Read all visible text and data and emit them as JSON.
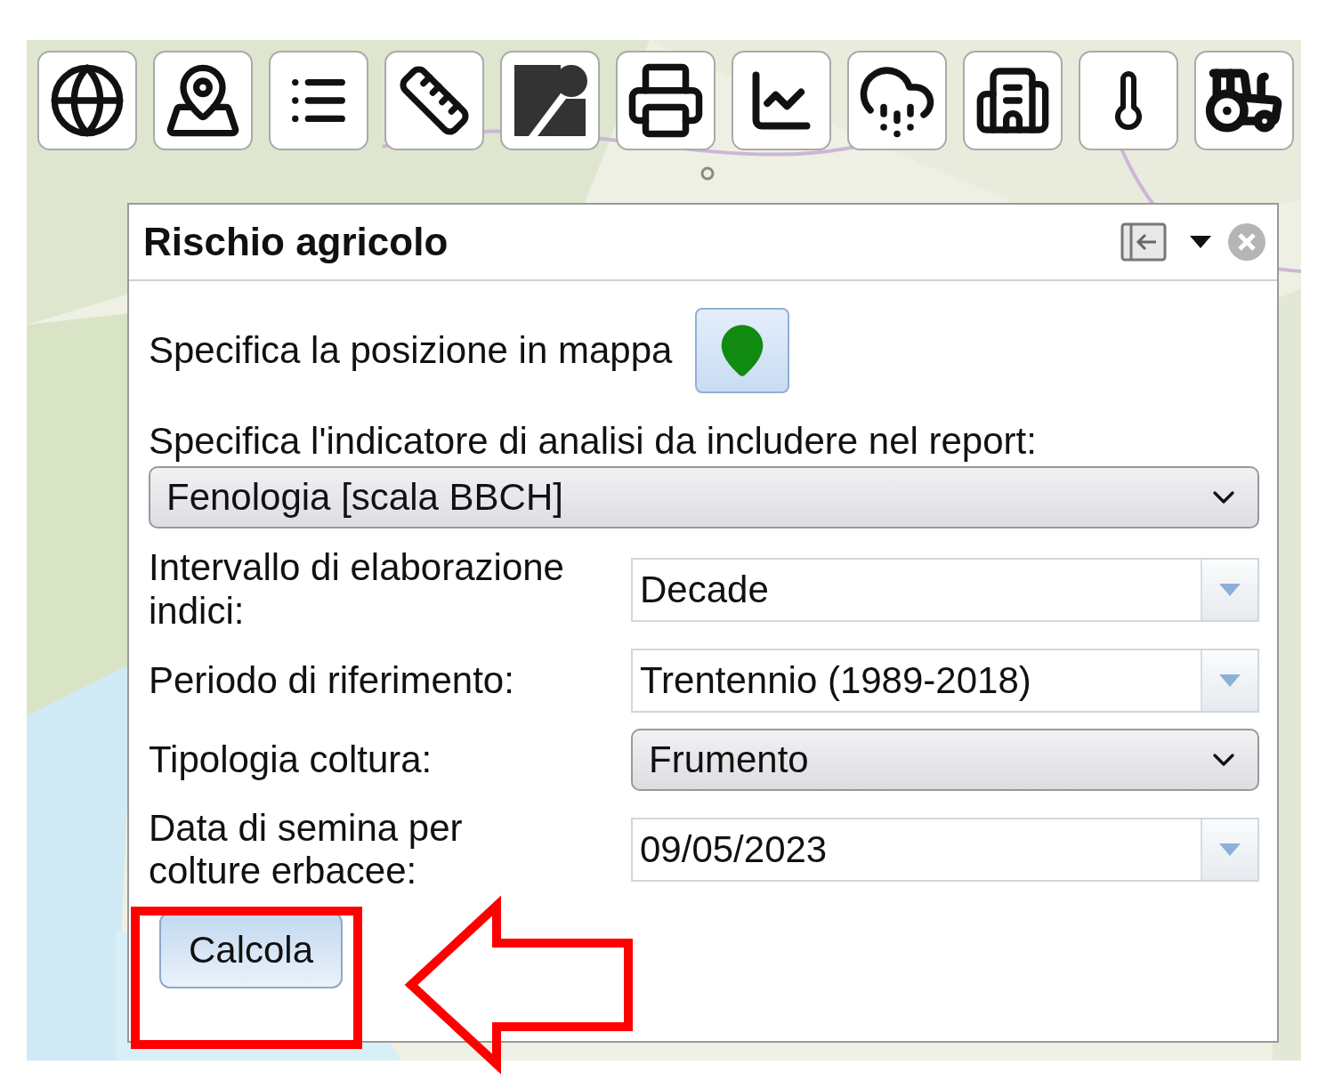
{
  "panel": {
    "title": "Rischio agricolo"
  },
  "location": {
    "label": "Specifica la posizione in mappa"
  },
  "indicator": {
    "label": "Specifica l'indicatore di analisi da includere nel report:",
    "value": "Fenologia [scala BBCH]"
  },
  "fields": [
    {
      "label": "Intervallo di elaborazione indici:",
      "value": "Decade",
      "kind": "combo"
    },
    {
      "label": "Periodo di riferimento:",
      "value": "Trentennio (1989-2018)",
      "kind": "combo"
    },
    {
      "label": "Tipologia coltura:",
      "value": "Frumento",
      "kind": "select"
    },
    {
      "label": "Data di semina per colture erbacee:",
      "value": "09/05/2023",
      "kind": "date"
    }
  ],
  "submit": {
    "label": "Calcola"
  }
}
